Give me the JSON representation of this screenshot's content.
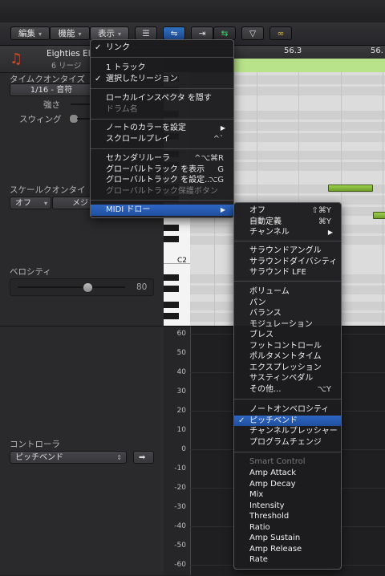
{
  "toolbar": {
    "edit": "編集",
    "functions": "機能",
    "view": "表示"
  },
  "ruler": {
    "bar1": "56.3",
    "bar2": "56."
  },
  "inspector": {
    "region_name": "Eighties El",
    "region_sub": "6 リージ",
    "time_quantize": "タイムクオンタイズ",
    "quantize_value": "1/16 - 音符",
    "strength": "強さ",
    "swing": "スウィング",
    "scale_quantize": "スケールクオンタイ",
    "scale_off": "オフ",
    "scale_major": "メジ",
    "velocity": "ベロシティ",
    "velocity_value": "80",
    "controller": "コントローラ",
    "controller_value": "ピッチベンド"
  },
  "keyboard": {
    "c2": "C2"
  },
  "controller_axis": [
    "60",
    "50",
    "40",
    "30",
    "20",
    "10",
    "0",
    "-10",
    "-20",
    "-30",
    "-40",
    "-50",
    "-60"
  ],
  "view_menu": {
    "link": "リンク",
    "one_track": "1 トラック",
    "selected_region": "選択したリージョン",
    "show_local_inspector": "ローカルインスペクタ を隠す",
    "drum_name": "ドラム名",
    "note_color": "ノートのカラーを設定",
    "scroll_play": "スクロールプレイ",
    "scroll_play_sc": "^`",
    "secondary_ruler": "セカンダリルーラ",
    "secondary_ruler_sc": "^⌥⌘R",
    "show_global": "グローバルトラック を表示",
    "show_global_sc": "G",
    "global_settings": "グローバルトラック を設定...",
    "global_settings_sc": "⌥G",
    "global_protect": "グローバルトラック保護ボタン",
    "midi_draw": "MIDI ドロー"
  },
  "midi_menu": {
    "off": "オフ",
    "off_sc": "⇧⌘Y",
    "auto": "自動定義",
    "auto_sc": "⌘Y",
    "channel": "チャンネル",
    "surround_angle": "サラウンドアングル",
    "surround_div": "サラウンドダイバシティ",
    "surround_lfe": "サラウンド LFE",
    "volume": "ボリューム",
    "pan": "パン",
    "balance": "バランス",
    "modulation": "モジュレーション",
    "breath": "ブレス",
    "foot": "フットコントロール",
    "portamento": "ポルタメントタイム",
    "expression": "エクスプレッション",
    "sustain": "サスティンペダル",
    "other": "その他...",
    "other_sc": "⌥Y",
    "note_on_vel": "ノートオンベロシティ",
    "pitch_bend": "ピッチベンド",
    "channel_pressure": "チャンネルプレッシャー",
    "program_change": "プログラムチェンジ",
    "smart_control": "Smart Control",
    "amp_attack": "Amp Attack",
    "amp_decay": "Amp Decay",
    "mix": "Mix",
    "intensity": "Intensity",
    "threshold": "Threshold",
    "ratio": "Ratio",
    "amp_sustain": "Amp Sustain",
    "amp_release": "Amp Release",
    "rate": "Rate"
  }
}
